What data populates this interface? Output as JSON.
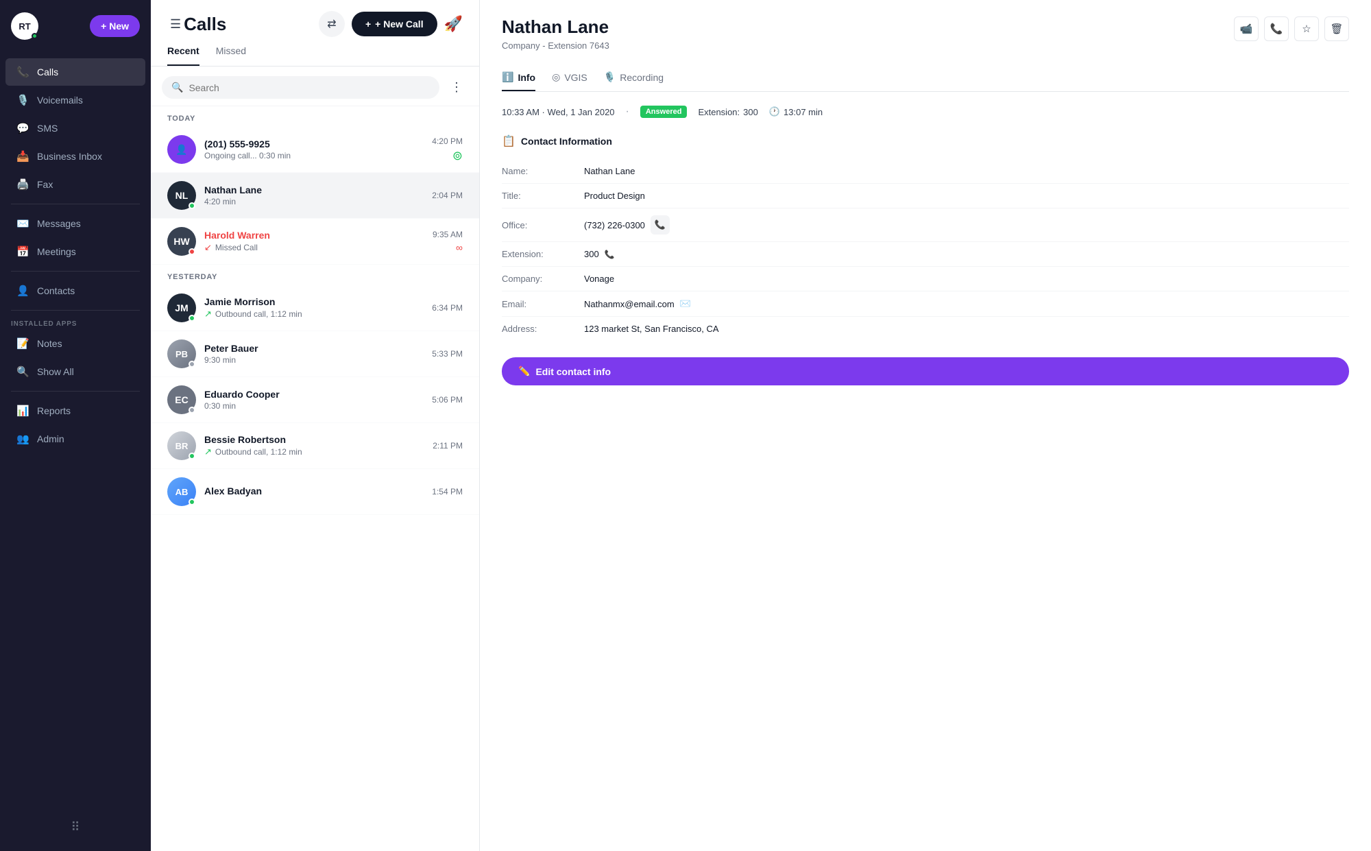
{
  "sidebar": {
    "avatar": "RT",
    "new_button": "+ New",
    "items": [
      {
        "id": "calls",
        "label": "Calls",
        "icon": "📞",
        "active": true
      },
      {
        "id": "voicemails",
        "label": "Voicemails",
        "icon": "🎙️",
        "active": false
      },
      {
        "id": "sms",
        "label": "SMS",
        "icon": "💬",
        "active": false
      },
      {
        "id": "business-inbox",
        "label": "Business Inbox",
        "icon": "📥",
        "active": false
      },
      {
        "id": "fax",
        "label": "Fax",
        "icon": "🖨️",
        "active": false
      },
      {
        "id": "messages",
        "label": "Messages",
        "icon": "✉️",
        "active": false
      },
      {
        "id": "meetings",
        "label": "Meetings",
        "icon": "📅",
        "active": false
      },
      {
        "id": "contacts",
        "label": "Contacts",
        "icon": "👤",
        "active": false
      }
    ],
    "installed_apps_label": "INSTALLED APPS",
    "bottom_items": [
      {
        "id": "notes",
        "label": "Notes",
        "icon": "📝"
      },
      {
        "id": "show-all",
        "label": "Show All",
        "icon": "🔍"
      },
      {
        "id": "reports",
        "label": "Reports",
        "icon": "📊"
      },
      {
        "id": "admin",
        "label": "Admin",
        "icon": "👥"
      }
    ]
  },
  "calls_panel": {
    "title": "Calls",
    "tabs": [
      {
        "id": "recent",
        "label": "Recent",
        "active": true
      },
      {
        "id": "missed",
        "label": "Missed",
        "active": false
      }
    ],
    "search_placeholder": "Search",
    "sections": [
      {
        "label": "TODAY",
        "items": [
          {
            "id": "unknown",
            "initials": "",
            "avatar_color": "#7c3aed",
            "avatar_icon": "👤",
            "name": "(201) 555-9925",
            "detail": "Ongoing call... 0:30 min",
            "time": "4:20 PM",
            "status": "ongoing",
            "status_dot": null,
            "is_photo": false,
            "is_missed": false,
            "call_direction": null
          },
          {
            "id": "nathan-lane",
            "initials": "NL",
            "avatar_color": "#1f2937",
            "name": "Nathan Lane",
            "detail": "4:20 min",
            "time": "2:04 PM",
            "status": "normal",
            "status_dot": "green",
            "is_photo": false,
            "is_missed": false,
            "call_direction": null,
            "active": true
          },
          {
            "id": "harold-warren",
            "initials": "HW",
            "avatar_color": "#374151",
            "name": "Harold Warren",
            "detail": "Missed Call",
            "time": "9:35 AM",
            "status": "voicemail",
            "status_dot": "red",
            "is_photo": false,
            "is_missed": true,
            "call_direction": "missed"
          }
        ]
      },
      {
        "label": "YESTERDAY",
        "items": [
          {
            "id": "jamie-morrison",
            "initials": "JM",
            "avatar_color": "#1f2937",
            "name": "Jamie Morrison",
            "detail": "Outbound call, 1:12 min",
            "time": "6:34 PM",
            "status": "normal",
            "status_dot": "green",
            "is_photo": false,
            "is_missed": false,
            "call_direction": "outbound"
          },
          {
            "id": "peter-bauer",
            "initials": "PB",
            "name": "Peter Bauer",
            "detail": "9:30 min",
            "time": "5:33 PM",
            "status": "normal",
            "status_dot": "gray",
            "is_photo": true,
            "avatar_color": "#9ca3af",
            "is_missed": false,
            "call_direction": null
          },
          {
            "id": "eduardo-cooper",
            "initials": "EC",
            "avatar_color": "#6b7280",
            "name": "Eduardo Cooper",
            "detail": "0:30 min",
            "time": "5:06 PM",
            "status": "normal",
            "status_dot": "gray",
            "is_photo": false,
            "is_missed": false,
            "call_direction": null
          },
          {
            "id": "bessie-robertson",
            "initials": "BR",
            "name": "Bessie Robertson",
            "detail": "Outbound call, 1:12 min",
            "time": "2:11 PM",
            "status": "normal",
            "status_dot": "green",
            "is_photo": true,
            "avatar_color": "#9ca3af",
            "is_missed": false,
            "call_direction": "outbound"
          },
          {
            "id": "alex-badyan",
            "initials": "AB",
            "name": "Alex Badyan",
            "detail": "",
            "time": "1:54 PM",
            "status": "normal",
            "status_dot": "green",
            "is_photo": true,
            "avatar_color": "#9ca3af",
            "is_missed": false,
            "call_direction": null
          }
        ]
      }
    ]
  },
  "detail": {
    "name": "Nathan Lane",
    "subtitle": "Company  -  Extension 7643",
    "tabs": [
      {
        "id": "info",
        "label": "Info",
        "icon": "ℹ️",
        "active": true
      },
      {
        "id": "vgis",
        "label": "VGIS",
        "icon": "◎",
        "active": false
      },
      {
        "id": "recording",
        "label": "Recording",
        "icon": "🎙️",
        "active": false
      }
    ],
    "call_meta": {
      "datetime": "10:33 AM · Wed, 1 Jan 2020",
      "status": "Answered",
      "extension_label": "Extension:",
      "extension_value": "300",
      "duration_label": "",
      "duration": "13:07 min"
    },
    "contact_info": {
      "section_title": "Contact Information",
      "fields": [
        {
          "label": "Name:",
          "value": "Nathan Lane",
          "has_action": false
        },
        {
          "label": "Title:",
          "value": "Product  Design",
          "has_action": false
        },
        {
          "label": "Office:",
          "value": "(732) 226-0300",
          "has_action": true,
          "action_icon": "📞"
        },
        {
          "label": "Extension:",
          "value": "300",
          "has_action": true,
          "action_icon": "📞"
        },
        {
          "label": "Company:",
          "value": "Vonage",
          "has_action": false
        },
        {
          "label": "Email:",
          "value": "Nathanmx@email.com",
          "has_action": true,
          "action_icon": "✉️"
        },
        {
          "label": "Address:",
          "value": "123 market St, San Francisco, CA",
          "has_action": false
        }
      ]
    },
    "edit_button": "Edit contact info"
  },
  "topbar": {
    "transfer_icon": "🔄",
    "new_call_label": "+ New Call",
    "rocket_icon": "🚀"
  }
}
